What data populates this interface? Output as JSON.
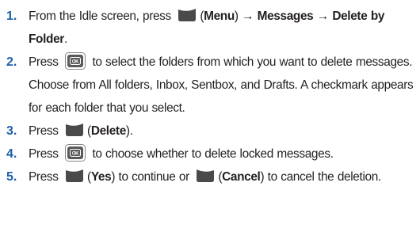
{
  "steps": [
    {
      "num": "1.",
      "t1": "From the Idle screen, press",
      "t2": "(",
      "t3": "Menu",
      "t4": ")",
      "t5": "Messages",
      "t6": "Delete by Folder",
      "t7": ".",
      "arrow": "→",
      "icon1": "left-softkey-icon"
    },
    {
      "num": "2.",
      "t1": "Press",
      "t2": "to select the folders from which you want to delete messages. Choose from All folders, Inbox, Sentbox, and Drafts. A checkmark appears for each folder that you select.",
      "icon1": "ok-key-icon"
    },
    {
      "num": "3.",
      "t1": "Press",
      "t2": "(",
      "t3": "Delete",
      "t4": ").",
      "icon1": "left-softkey-icon"
    },
    {
      "num": "4.",
      "t1": "Press",
      "t2": "to choose whether to delete locked messages.",
      "icon1": "ok-key-icon"
    },
    {
      "num": "5.",
      "t1": "Press",
      "t2": "(",
      "t3": "Yes",
      "t4": ") to continue or",
      "t5": "(",
      "t6": "Cancel",
      "t7": ") to cancel the deletion.",
      "icon1": "left-softkey-icon",
      "icon2": "right-softkey-icon"
    }
  ],
  "colors": {
    "step_number": "#1f5fa8",
    "text": "#231f20",
    "softkey_fill": "#4a4a4a",
    "ok_key_fill": "#5a5a5a"
  }
}
